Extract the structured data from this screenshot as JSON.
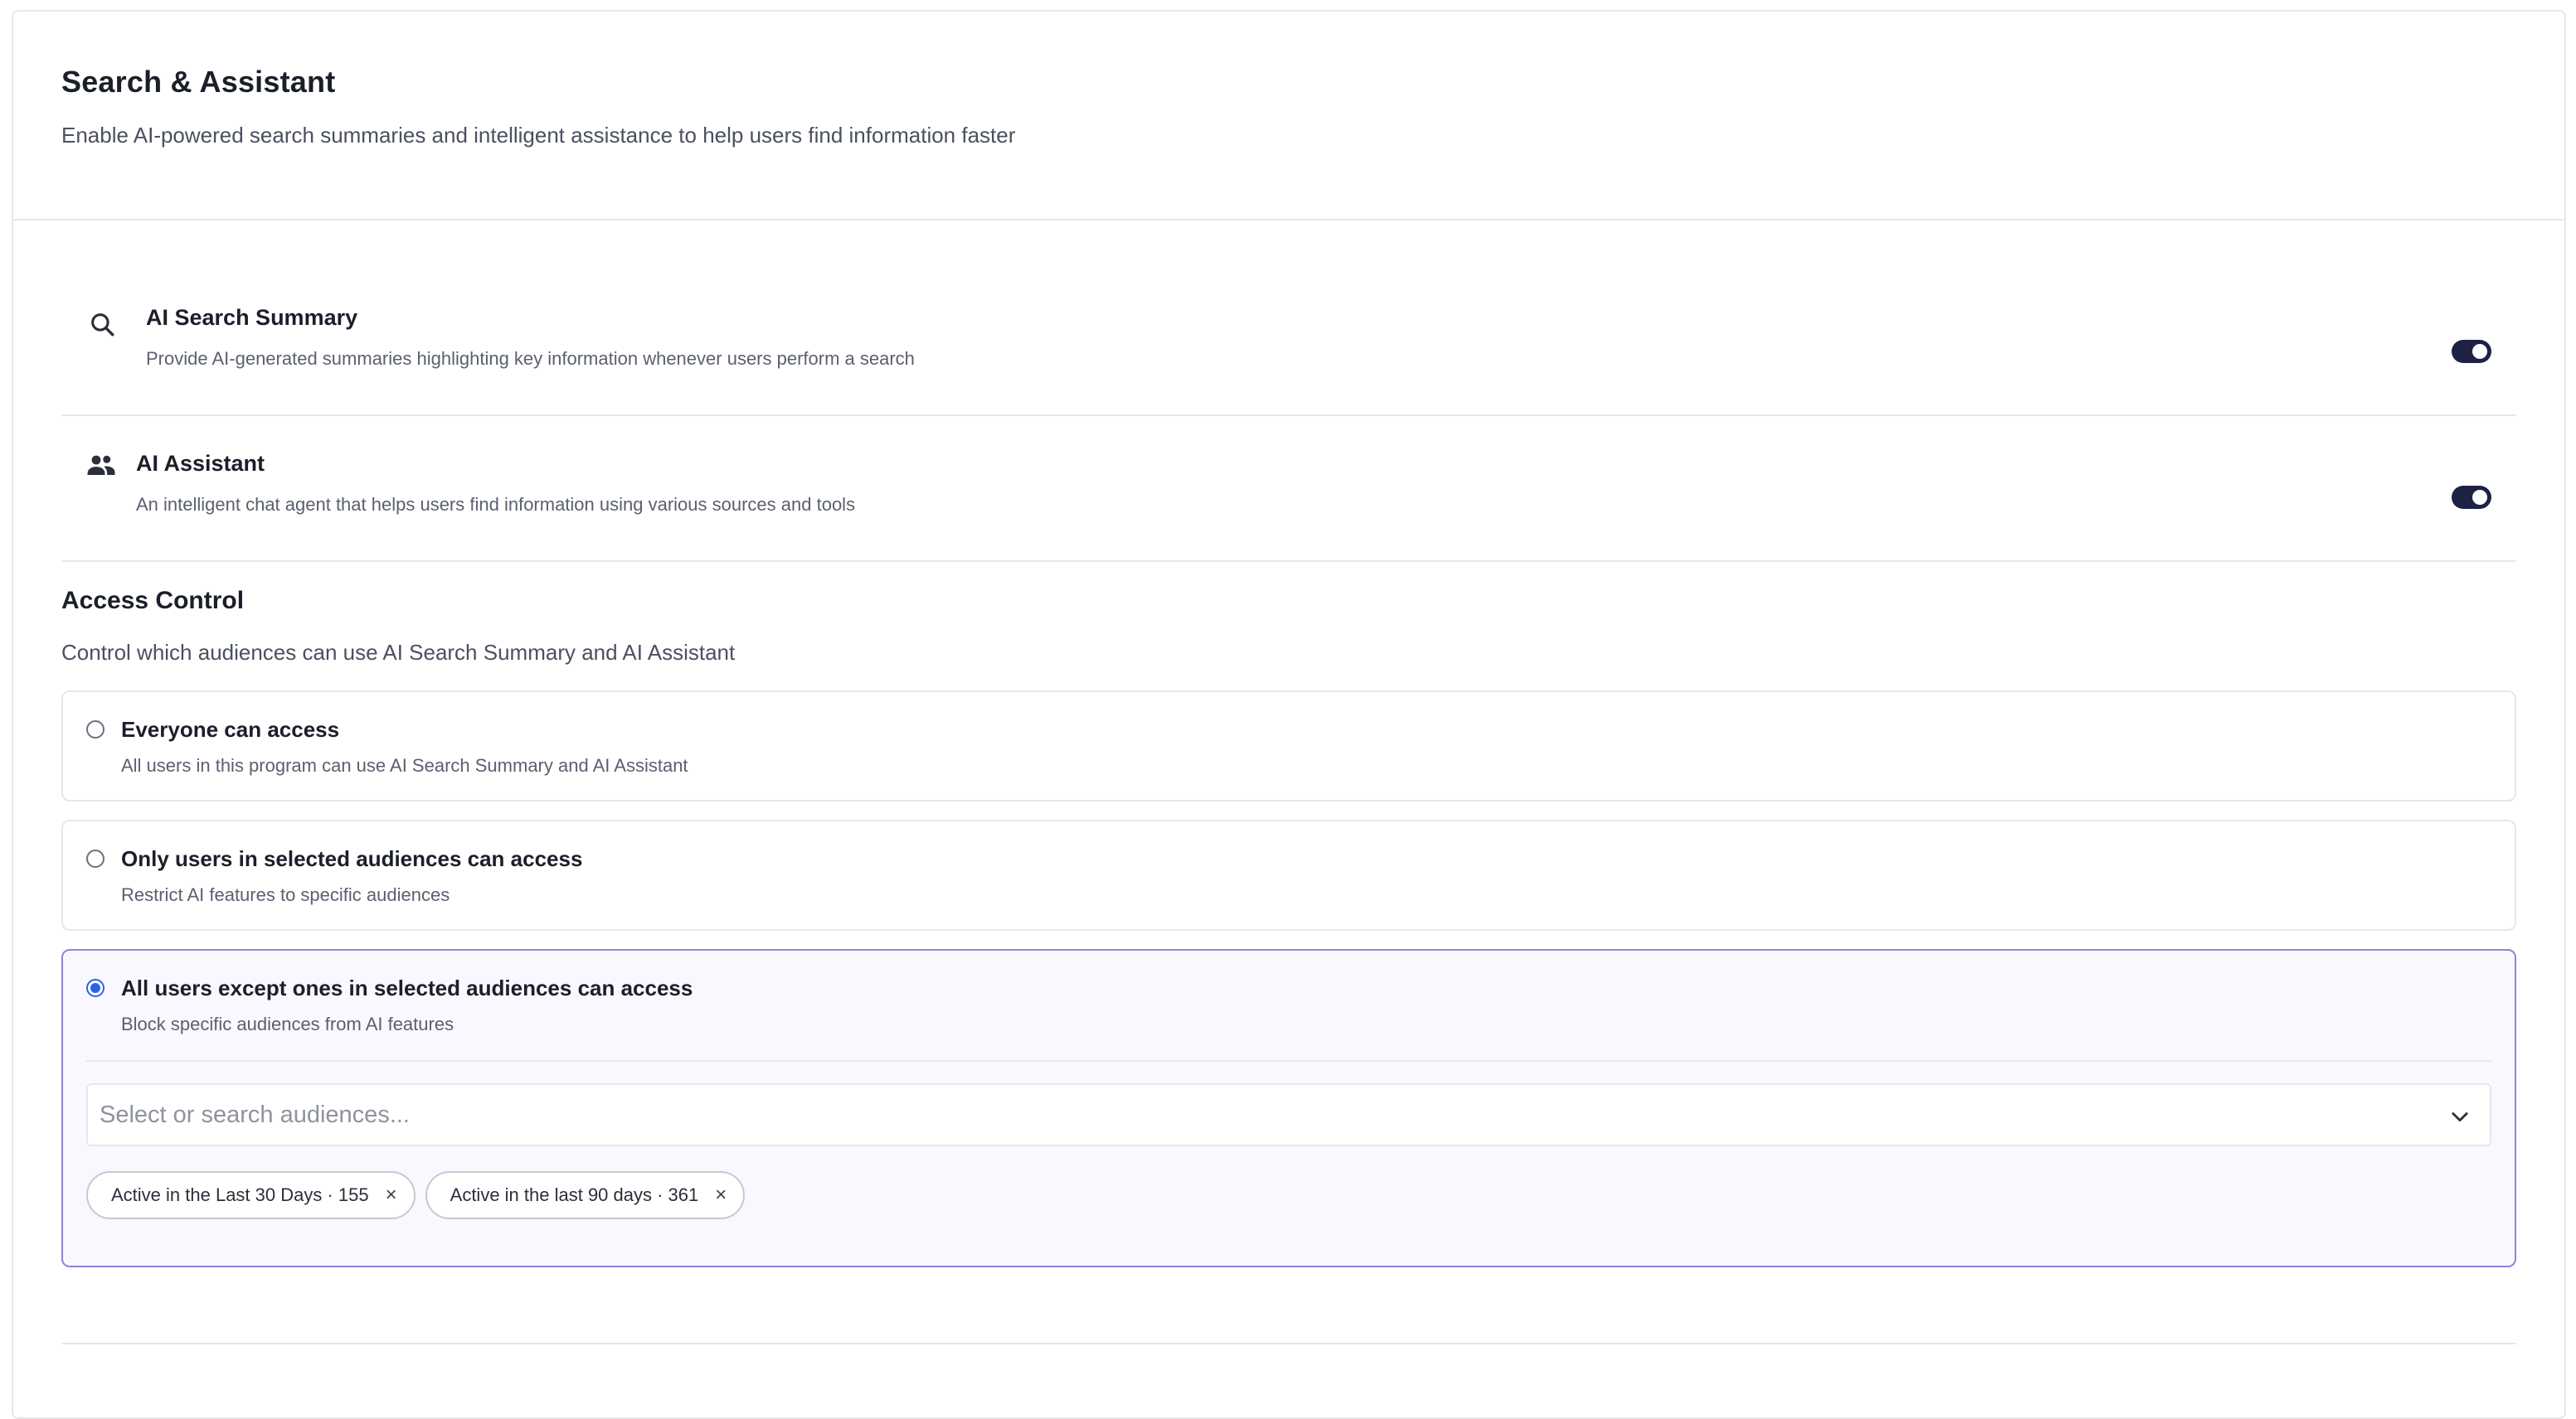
{
  "header": {
    "title": "Search & Assistant",
    "description": "Enable AI-powered search summaries and intelligent assistance to help users find information faster"
  },
  "features": [
    {
      "icon": "search-icon",
      "title": "AI Search Summary",
      "description": "Provide AI-generated summaries highlighting key information whenever users perform a search",
      "enabled": true
    },
    {
      "icon": "people-icon",
      "title": "AI Assistant",
      "description": "An intelligent chat agent that helps users find information using various sources and tools",
      "enabled": true
    }
  ],
  "access_control": {
    "title": "Access Control",
    "description": "Control which audiences can use AI Search Summary and AI Assistant",
    "options": [
      {
        "title": "Everyone can access",
        "description": "All users in this program can use AI Search Summary and AI Assistant",
        "selected": false
      },
      {
        "title": "Only users in selected audiences can access",
        "description": "Restrict AI features to specific audiences",
        "selected": false
      },
      {
        "title": "All users except ones in selected audiences can access",
        "description": "Block specific audiences from AI features",
        "selected": true
      }
    ],
    "audience_select": {
      "placeholder": "Select or search audiences..."
    },
    "selected_audiences": [
      {
        "label": "Active in the Last 30 Days · 155",
        "remove": "×"
      },
      {
        "label": "Active in the last 90 days · 361",
        "remove": "×"
      }
    ]
  },
  "colors": {
    "toggle_on": "#1d2245",
    "radio_selected": "#2b63e8",
    "selected_border": "#8b86d6",
    "selected_bg": "#f8f8fe"
  }
}
